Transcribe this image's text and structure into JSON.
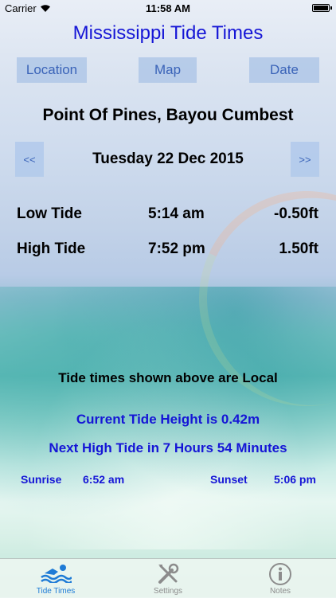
{
  "status_bar": {
    "carrier": "Carrier",
    "time": "11:58 AM"
  },
  "header": {
    "title": "Mississippi Tide Times"
  },
  "toolbar": {
    "location_label": "Location",
    "map_label": "Map",
    "date_label": "Date"
  },
  "location": {
    "name": "Point Of Pines, Bayou Cumbest"
  },
  "date_nav": {
    "prev_label": "<<",
    "date": "Tuesday 22 Dec 2015",
    "next_label": ">>"
  },
  "tides": [
    {
      "type": "Low Tide",
      "time": "5:14 am",
      "height": "-0.50ft"
    },
    {
      "type": "High Tide",
      "time": "7:52 pm",
      "height": "1.50ft"
    }
  ],
  "info": {
    "local_note": "Tide times shown above are Local",
    "current_height": "Current Tide Height is 0.42m",
    "next_tide": "Next High Tide in 7 Hours 54 Minutes",
    "sunrise_label": "Sunrise",
    "sunrise_time": "6:52 am",
    "sunset_label": "Sunset",
    "sunset_time": "5:06 pm"
  },
  "tab_bar": {
    "tabs": [
      {
        "label": "Tide Times",
        "icon": "swimmer-icon",
        "active": true
      },
      {
        "label": "Settings",
        "icon": "tools-icon",
        "active": false
      },
      {
        "label": "Notes",
        "icon": "info-icon",
        "active": false
      }
    ]
  },
  "colors": {
    "title_blue": "#1515d6",
    "button_text": "#3a63b8",
    "tab_active": "#1e7bd6",
    "tab_inactive": "#8c8c8c"
  }
}
